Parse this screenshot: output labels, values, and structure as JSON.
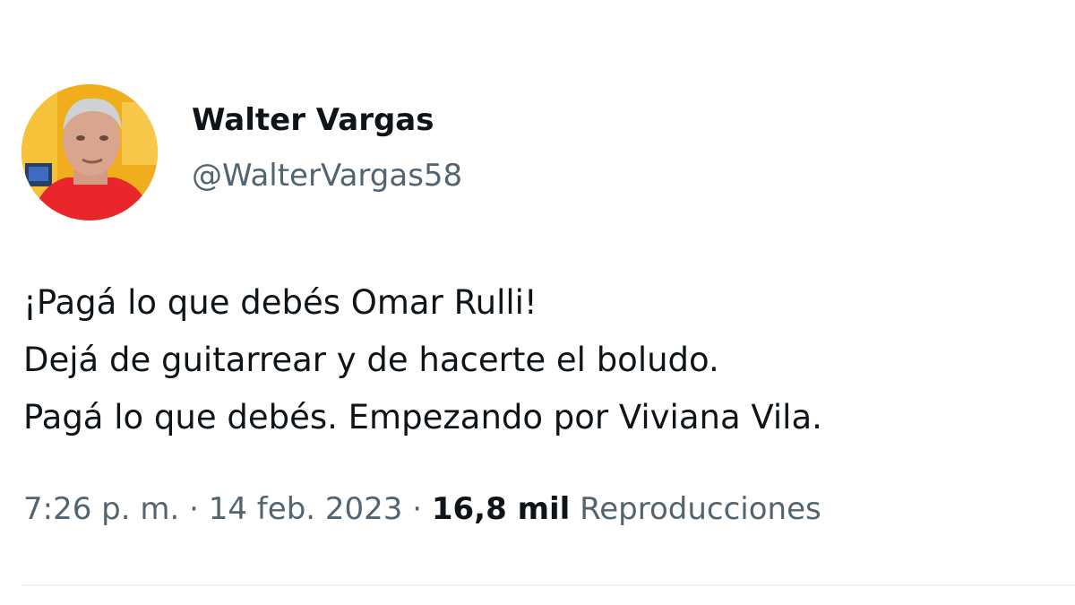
{
  "tweet": {
    "author": {
      "display_name": "Walter Vargas",
      "handle": "@WalterVargas58"
    },
    "text_lines": [
      "¡Pagá lo que debés Omar Rulli!",
      "Dejá de guitarrear y de hacerte el boludo.",
      "Pagá lo que debés. Empezando por Viviana Vila."
    ],
    "time": "7:26 p. m.",
    "separator": "·",
    "date": "14 feb. 2023",
    "views_count": "16,8 mil",
    "views_label": "Reproducciones"
  },
  "colors": {
    "text_primary": "#0f1419",
    "text_secondary": "#536471",
    "divider": "#eff3f4"
  }
}
